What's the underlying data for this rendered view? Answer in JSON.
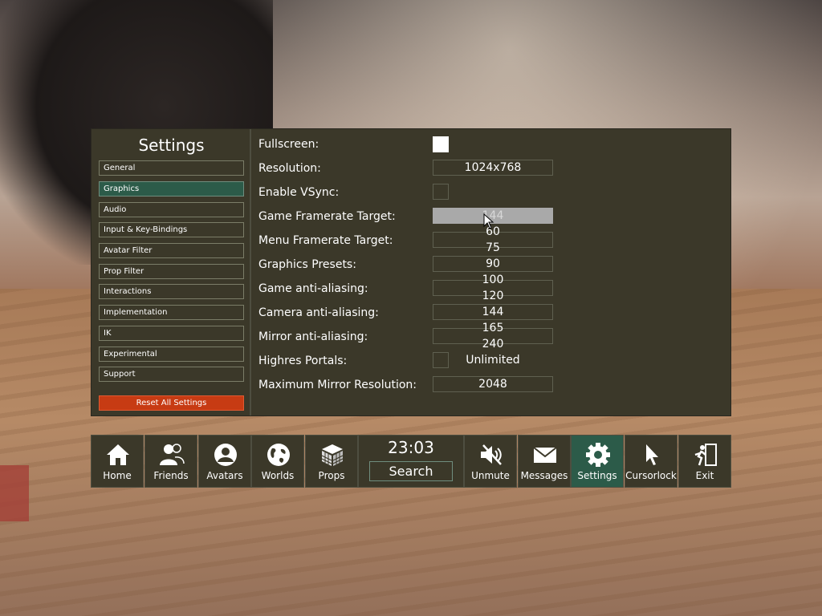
{
  "settings": {
    "title": "Settings",
    "categories": [
      "General",
      "Graphics",
      "Audio",
      "Input & Key-Bindings",
      "Avatar Filter",
      "Prop Filter",
      "Interactions",
      "Implementation",
      "IK",
      "Experimental",
      "Support"
    ],
    "active_category": "Graphics",
    "reset_label": "Reset All Settings",
    "options": {
      "fullscreen": {
        "label": "Fullscreen:",
        "checked": true
      },
      "resolution": {
        "label": "Resolution:",
        "value": "1024x768"
      },
      "vsync": {
        "label": "Enable VSync:",
        "checked": false
      },
      "game_framerate": {
        "label": "Game Framerate Target:",
        "value": "144"
      },
      "menu_framerate": {
        "label": "Menu Framerate Target:"
      },
      "graphics_presets": {
        "label": "Graphics Presets:"
      },
      "game_aa": {
        "label": "Game anti-aliasing:"
      },
      "camera_aa": {
        "label": "Camera anti-aliasing:"
      },
      "mirror_aa": {
        "label": "Mirror anti-aliasing:"
      },
      "highres_portals": {
        "label": "Highres Portals:"
      },
      "max_mirror_res": {
        "label": "Maximum Mirror Resolution:",
        "value": "2048"
      }
    },
    "framerate_dropdown": {
      "selected": "144",
      "options": [
        "60",
        "75",
        "90",
        "100",
        "120",
        "144",
        "165",
        "240",
        "Unlimited"
      ]
    }
  },
  "quickbar": {
    "clock": "23:03",
    "search_label": "Search",
    "left_buttons": [
      {
        "label": "Home",
        "icon": "home-icon"
      },
      {
        "label": "Friends",
        "icon": "friends-icon"
      },
      {
        "label": "Avatars",
        "icon": "avatars-icon"
      },
      {
        "label": "Worlds",
        "icon": "worlds-icon"
      },
      {
        "label": "Props",
        "icon": "props-icon"
      }
    ],
    "right_buttons": [
      {
        "label": "Unmute",
        "icon": "muted-speaker-icon"
      },
      {
        "label": "Messages",
        "icon": "messages-icon"
      },
      {
        "label": "Settings",
        "icon": "gear-icon",
        "active": true
      },
      {
        "label": "Cursorlock",
        "icon": "cursor-icon"
      },
      {
        "label": "Exit",
        "icon": "exit-icon"
      }
    ]
  },
  "colors": {
    "panel_bg": "#3b3829",
    "active_green": "#2c5b49",
    "reset_red": "#c73b13"
  }
}
